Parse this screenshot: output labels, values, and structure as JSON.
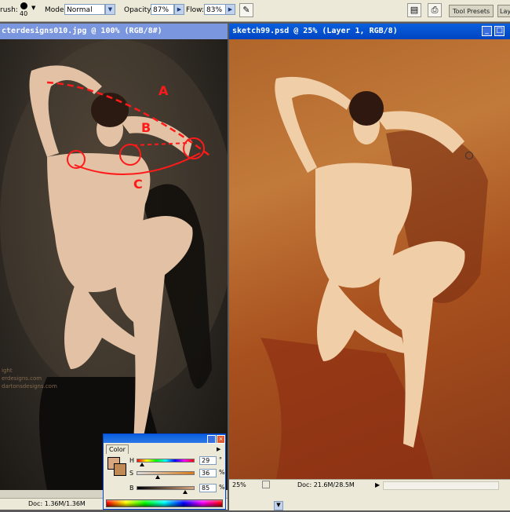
{
  "options_bar": {
    "brush_label": "rush:",
    "brush_size": "40",
    "mode_label": "Mode:",
    "mode_value": "Normal",
    "opacity_label": "Opacity:",
    "opacity_value": "87%",
    "flow_label": "Flow:",
    "flow_value": "83%",
    "tool_presets_tab": "Tool Presets",
    "layers_tab": "Lay"
  },
  "doc_left": {
    "title": "cterdesigns010.jpg @ 100% (RGB/8#)",
    "status": "Doc: 1.36M/1.36M",
    "annotations": [
      "A",
      "B",
      "C"
    ],
    "watermark": [
      "ight",
      "erdesigns.com",
      "dartonsdesigns.com"
    ]
  },
  "doc_right": {
    "title": "sketch99.psd @ 25% (Layer 1, RGB/8)",
    "zoom": "25%",
    "status": "Doc: 21.6M/28.5M"
  },
  "color_panel": {
    "tab": "Color",
    "h_label": "H",
    "s_label": "S",
    "b_label": "B",
    "h_value": "29",
    "s_value": "36",
    "b_value": "85",
    "h_unit": "°",
    "s_unit": "%",
    "b_unit": "%",
    "h_level": 0.08,
    "s_level": 0.36,
    "b_level": 0.85,
    "foreground_color": "#d9a77f",
    "background_color": "#c08a56"
  },
  "colors": {
    "accent_active_title": "#0a5fde",
    "inactive_title": "#7a96df",
    "annotation_red": "#ff1a1a"
  }
}
